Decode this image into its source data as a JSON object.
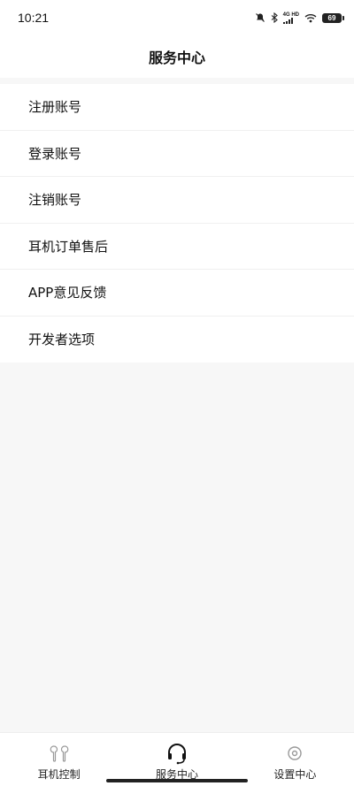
{
  "status_bar": {
    "time": "10:21",
    "network_top": "4G HD",
    "network_bottom": "all",
    "battery": "69"
  },
  "header": {
    "title": "服务中心"
  },
  "menu": {
    "items": [
      {
        "label": "注册账号"
      },
      {
        "label": "登录账号"
      },
      {
        "label": "注销账号"
      },
      {
        "label": "耳机订单售后"
      },
      {
        "label": "APP意见反馈"
      },
      {
        "label": "开发者选项"
      }
    ]
  },
  "tab_bar": {
    "tabs": [
      {
        "label": "耳机控制",
        "icon": "earbuds-icon"
      },
      {
        "label": "服务中心",
        "icon": "headset-icon",
        "active": true
      },
      {
        "label": "设置中心",
        "icon": "settings-icon"
      }
    ]
  },
  "colors": {
    "background": "#f7f7f7",
    "surface": "#ffffff",
    "text": "#111111"
  }
}
